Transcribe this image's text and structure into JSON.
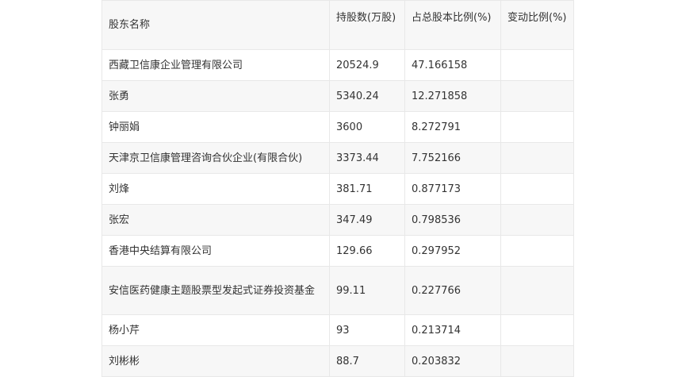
{
  "table": {
    "headers": [
      "股东名称",
      "持股数(万股)",
      "占总股本比例(%)",
      "变动比例(%)"
    ],
    "rows": [
      {
        "name": "西藏卫信康企业管理有限公司",
        "shares": "20524.9",
        "ratio": "47.166158",
        "change": ""
      },
      {
        "name": "张勇",
        "shares": "5340.24",
        "ratio": "12.271858",
        "change": ""
      },
      {
        "name": "钟丽娟",
        "shares": "3600",
        "ratio": "8.272791",
        "change": ""
      },
      {
        "name": "天津京卫信康管理咨询合伙企业(有限合伙)",
        "shares": "3373.44",
        "ratio": "7.752166",
        "change": ""
      },
      {
        "name": "刘烽",
        "shares": "381.71",
        "ratio": "0.877173",
        "change": ""
      },
      {
        "name": "张宏",
        "shares": "347.49",
        "ratio": "0.798536",
        "change": ""
      },
      {
        "name": "香港中央结算有限公司",
        "shares": "129.66",
        "ratio": "0.297952",
        "change": ""
      },
      {
        "name": "安信医药健康主题股票型发起式证券投资基金",
        "shares": "99.11",
        "ratio": "0.227766",
        "change": ""
      },
      {
        "name": "杨小芹",
        "shares": "93",
        "ratio": "0.213714",
        "change": ""
      },
      {
        "name": "刘彬彬",
        "shares": "88.7",
        "ratio": "0.203832",
        "change": ""
      }
    ]
  }
}
